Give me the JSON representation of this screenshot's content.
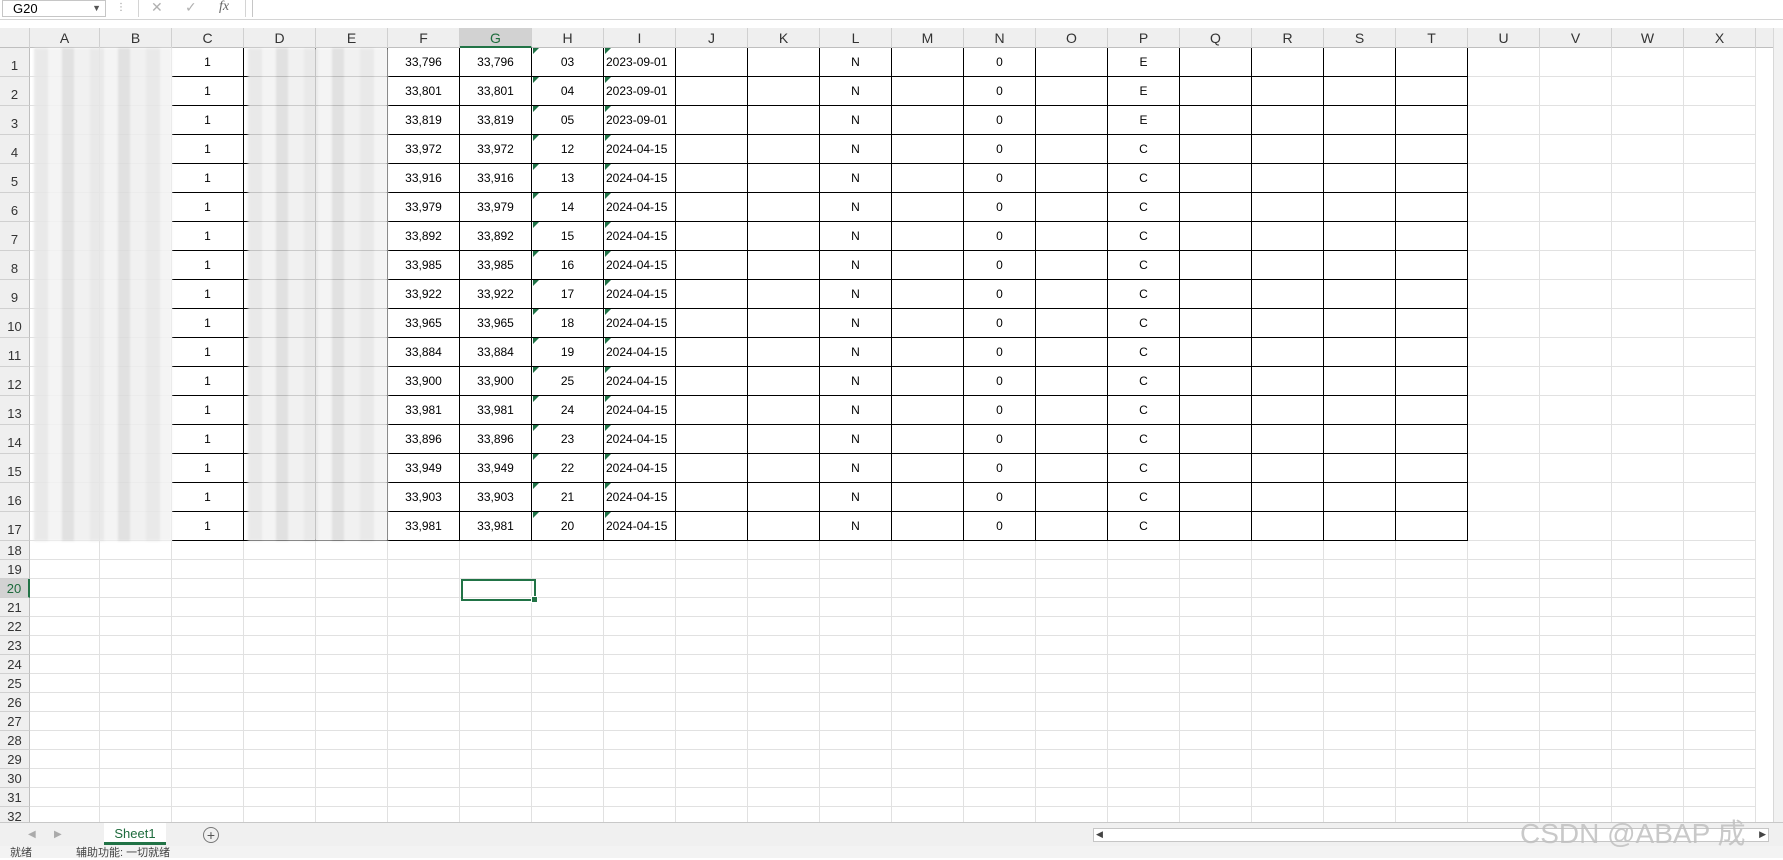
{
  "name_box": "G20",
  "formula_icons": [
    "close-icon",
    "check-icon",
    "fx-icon"
  ],
  "columns": [
    "A",
    "B",
    "C",
    "D",
    "E",
    "F",
    "G",
    "H",
    "I",
    "J",
    "K",
    "L",
    "M",
    "N",
    "O",
    "P",
    "Q",
    "R",
    "S",
    "T",
    "U",
    "V",
    "W",
    "X"
  ],
  "selected_column": "G",
  "row_numbers": [
    "1",
    "2",
    "3",
    "4",
    "5",
    "6",
    "7",
    "8",
    "9",
    "10",
    "11",
    "12",
    "13",
    "14",
    "15",
    "16",
    "17",
    "18",
    "19",
    "20",
    "21",
    "22",
    "23",
    "24",
    "25",
    "26",
    "27",
    "28",
    "29",
    "30",
    "31",
    "32"
  ],
  "selected_row": "20",
  "rows": [
    {
      "C": "1",
      "F": "33,796",
      "G": "33,796",
      "H": "03",
      "I": "2023-09-01",
      "L": "N",
      "N": "0",
      "P": "E"
    },
    {
      "C": "1",
      "F": "33,801",
      "G": "33,801",
      "H": "04",
      "I": "2023-09-01",
      "L": "N",
      "N": "0",
      "P": "E"
    },
    {
      "C": "1",
      "F": "33,819",
      "G": "33,819",
      "H": "05",
      "I": "2023-09-01",
      "L": "N",
      "N": "0",
      "P": "E"
    },
    {
      "C": "1",
      "F": "33,972",
      "G": "33,972",
      "H": "12",
      "I": "2024-04-15",
      "L": "N",
      "N": "0",
      "P": "C"
    },
    {
      "C": "1",
      "F": "33,916",
      "G": "33,916",
      "H": "13",
      "I": "2024-04-15",
      "L": "N",
      "N": "0",
      "P": "C"
    },
    {
      "C": "1",
      "F": "33,979",
      "G": "33,979",
      "H": "14",
      "I": "2024-04-15",
      "L": "N",
      "N": "0",
      "P": "C"
    },
    {
      "C": "1",
      "F": "33,892",
      "G": "33,892",
      "H": "15",
      "I": "2024-04-15",
      "L": "N",
      "N": "0",
      "P": "C"
    },
    {
      "C": "1",
      "F": "33,985",
      "G": "33,985",
      "H": "16",
      "I": "2024-04-15",
      "L": "N",
      "N": "0",
      "P": "C"
    },
    {
      "C": "1",
      "F": "33,922",
      "G": "33,922",
      "H": "17",
      "I": "2024-04-15",
      "L": "N",
      "N": "0",
      "P": "C"
    },
    {
      "C": "1",
      "F": "33,965",
      "G": "33,965",
      "H": "18",
      "I": "2024-04-15",
      "L": "N",
      "N": "0",
      "P": "C"
    },
    {
      "C": "1",
      "F": "33,884",
      "G": "33,884",
      "H": "19",
      "I": "2024-04-15",
      "L": "N",
      "N": "0",
      "P": "C"
    },
    {
      "C": "1",
      "F": "33,900",
      "G": "33,900",
      "H": "25",
      "I": "2024-04-15",
      "L": "N",
      "N": "0",
      "P": "C"
    },
    {
      "C": "1",
      "F": "33,981",
      "G": "33,981",
      "H": "24",
      "I": "2024-04-15",
      "L": "N",
      "N": "0",
      "P": "C"
    },
    {
      "C": "1",
      "F": "33,896",
      "G": "33,896",
      "H": "23",
      "I": "2024-04-15",
      "L": "N",
      "N": "0",
      "P": "C"
    },
    {
      "C": "1",
      "F": "33,949",
      "G": "33,949",
      "H": "22",
      "I": "2024-04-15",
      "L": "N",
      "N": "0",
      "P": "C"
    },
    {
      "C": "1",
      "F": "33,903",
      "G": "33,903",
      "H": "21",
      "I": "2024-04-15",
      "L": "N",
      "N": "0",
      "P": "C"
    },
    {
      "C": "1",
      "F": "33,981",
      "G": "33,981",
      "H": "20",
      "I": "2024-04-15",
      "L": "N",
      "N": "0",
      "P": "C"
    }
  ],
  "sheet_tabs": [
    "Sheet1"
  ],
  "add_sheet_label": "+",
  "status_bar": {
    "ready": "就绪",
    "accessibility": "辅助功能: 一切就绪"
  },
  "watermark": "CSDN @ABAP 成",
  "colors": {
    "accent": "#217346",
    "header_bg": "#efefef",
    "gridline": "#e1e1e1"
  }
}
